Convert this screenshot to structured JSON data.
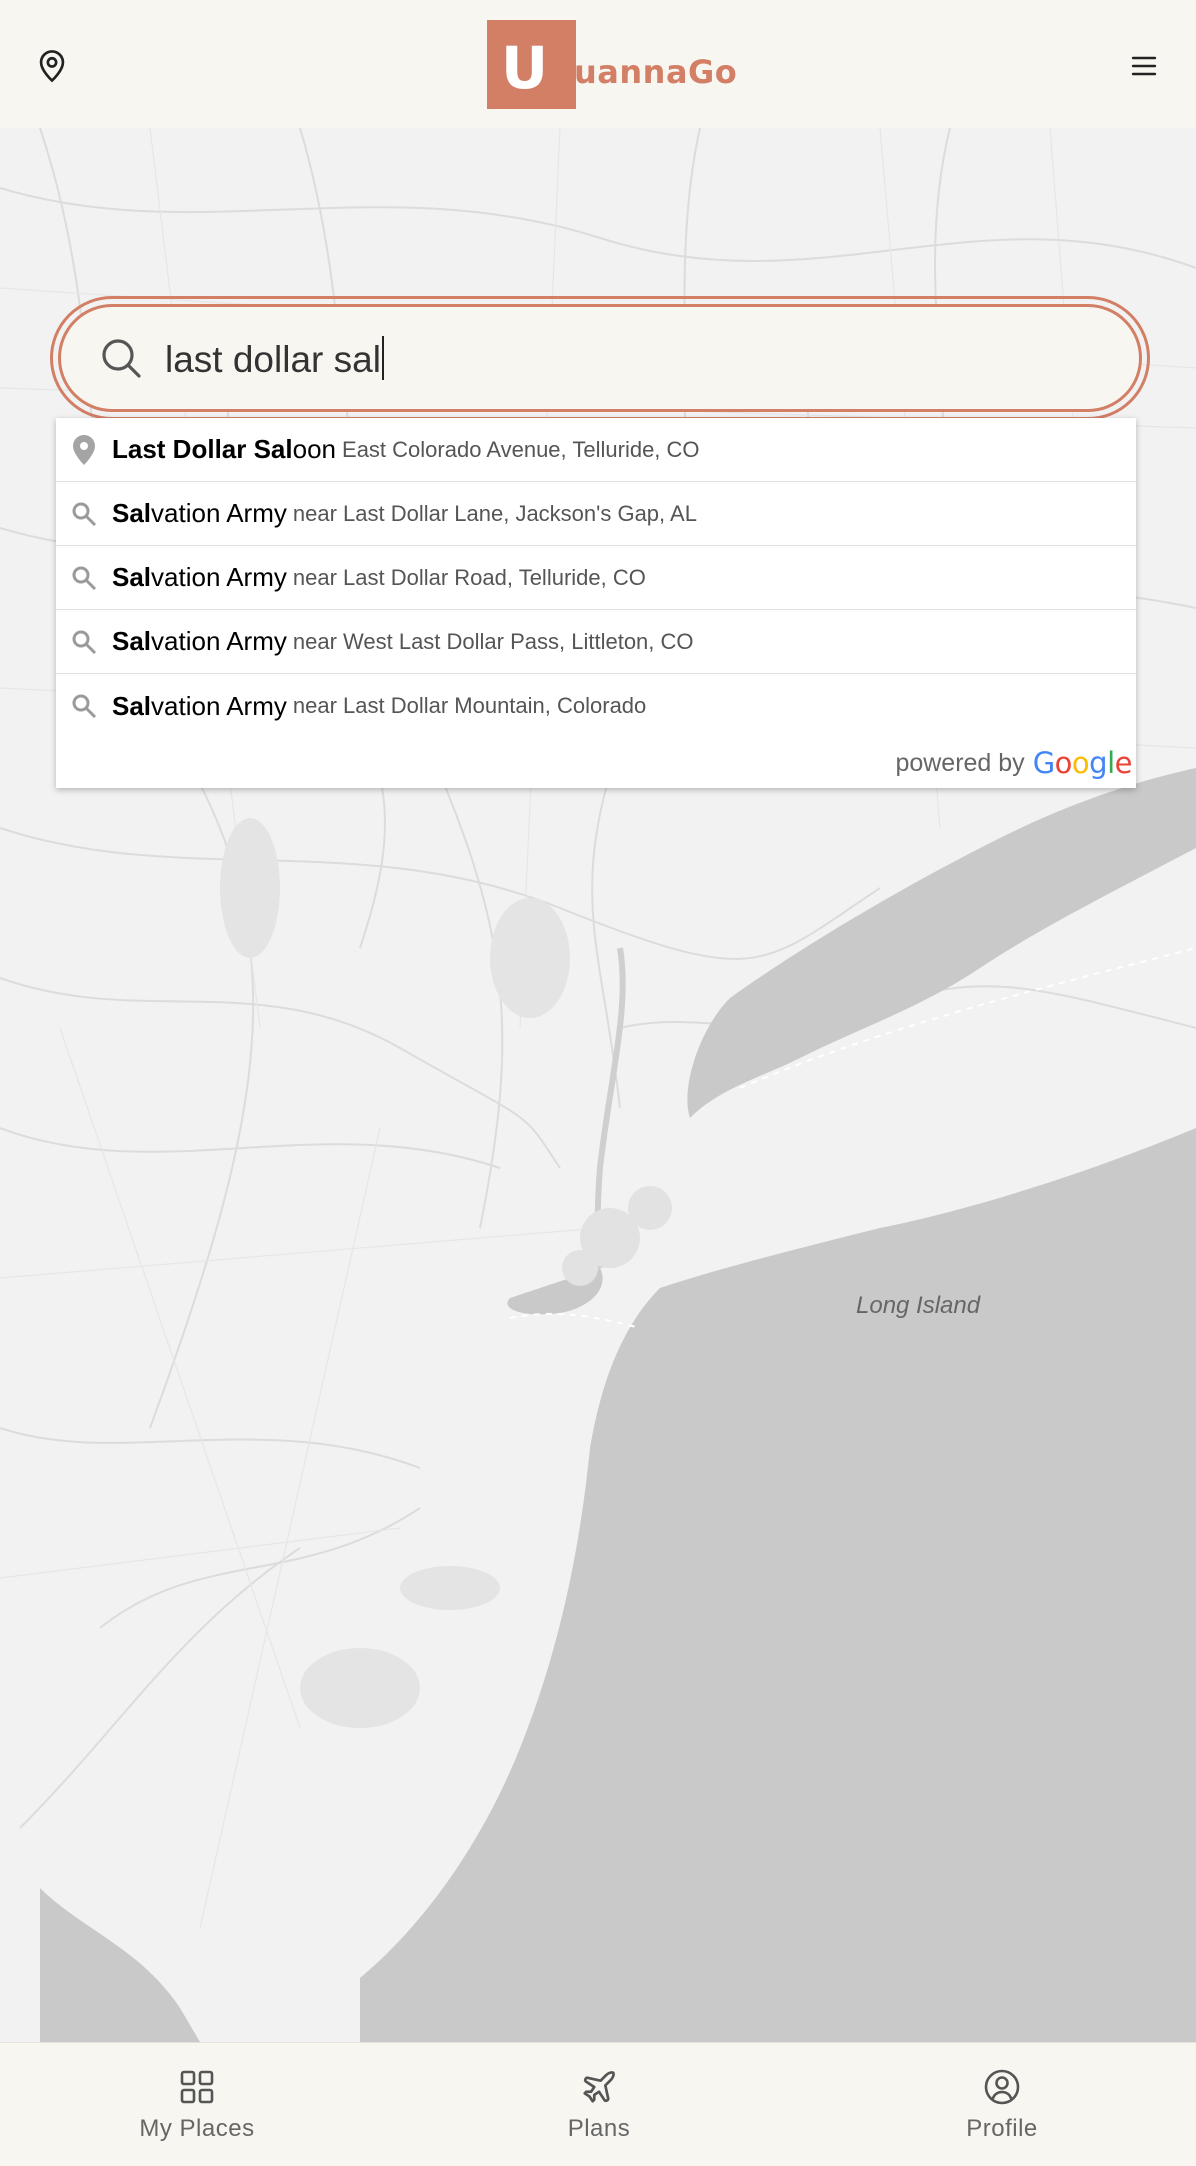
{
  "header": {
    "logo_letter": "U",
    "logo_text": "uannaGo",
    "location_icon": "map-pin-icon",
    "menu_icon": "hamburger-menu-icon"
  },
  "search": {
    "value": "last dollar sal",
    "icon": "search-icon"
  },
  "suggestions": [
    {
      "icon": "place-pin-icon",
      "match": "Last Dollar Sal",
      "rest": "oon",
      "secondary": "East Colorado Avenue, Telluride, CO"
    },
    {
      "icon": "search-icon",
      "match": "Sal",
      "rest": "vation Army",
      "secondary": "near Last Dollar Lane, Jackson's Gap, AL"
    },
    {
      "icon": "search-icon",
      "match": "Sal",
      "rest": "vation Army",
      "secondary": "near Last Dollar Road, Telluride, CO"
    },
    {
      "icon": "search-icon",
      "match": "Sal",
      "rest": "vation Army",
      "secondary": "near West Last Dollar Pass, Littleton, CO"
    },
    {
      "icon": "search-icon",
      "match": "Sal",
      "rest": "vation Army",
      "secondary": "near Last Dollar Mountain, Colorado"
    }
  ],
  "powered_by": {
    "prefix": "powered by",
    "brand": "Google"
  },
  "map": {
    "label": "Long Island"
  },
  "nav": [
    {
      "label": "My Places",
      "icon": "grid-icon"
    },
    {
      "label": "Plans",
      "icon": "airplane-icon"
    },
    {
      "label": "Profile",
      "icon": "user-circle-icon"
    }
  ],
  "colors": {
    "accent": "#d27f66",
    "header_bg": "#f8f6f1",
    "map_land": "#f2f2f2",
    "map_water": "#c9c9c9",
    "map_roads": "#dcdcdc"
  }
}
